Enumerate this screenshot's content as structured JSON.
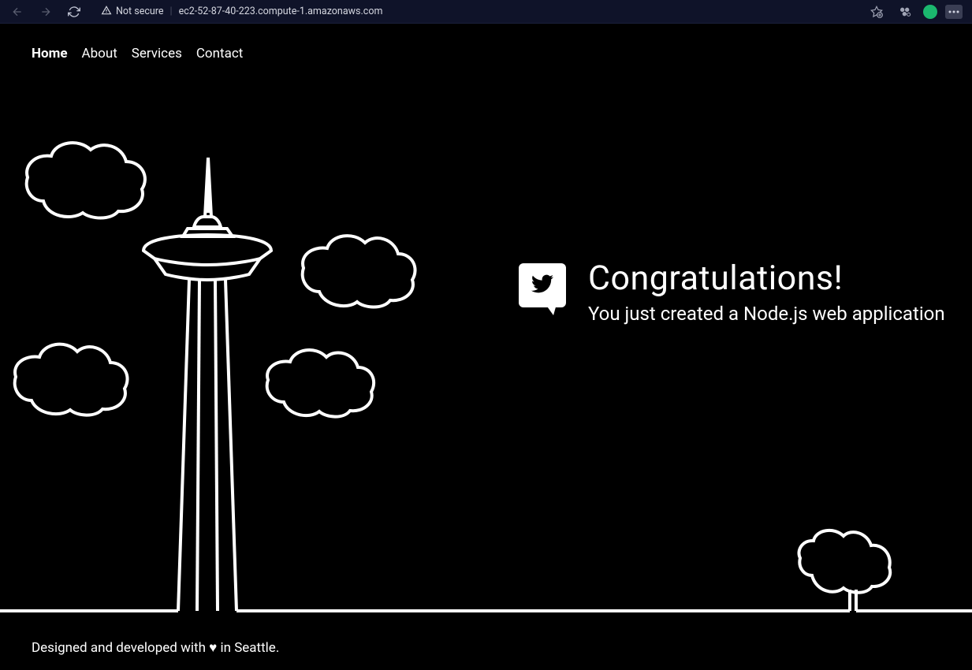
{
  "browser": {
    "not_secure_label": "Not secure",
    "url": "ec2-52-87-40-223.compute-1.amazonaws.com"
  },
  "nav": {
    "items": [
      {
        "label": "Home",
        "active": true
      },
      {
        "label": "About",
        "active": false
      },
      {
        "label": "Services",
        "active": false
      },
      {
        "label": "Contact",
        "active": false
      }
    ]
  },
  "hero": {
    "title": "Congratulations!",
    "subtitle": "You just created a Node.js web application"
  },
  "footer": {
    "text": "Designed and developed with ♥ in Seattle."
  }
}
